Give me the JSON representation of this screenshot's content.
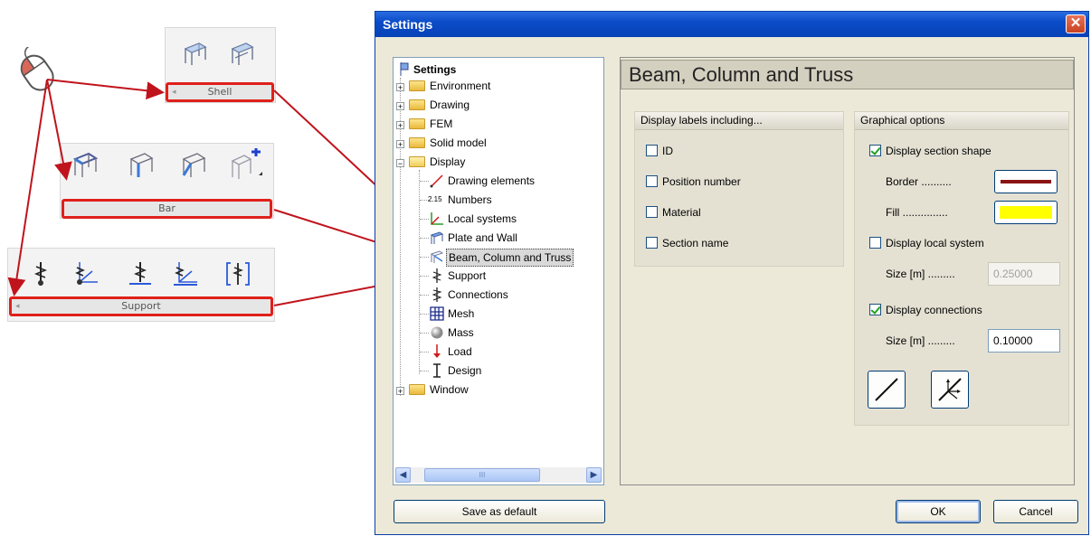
{
  "toolbars": {
    "shell": {
      "caption": "Shell"
    },
    "bar": {
      "caption": "Bar"
    },
    "support": {
      "caption": "Support"
    }
  },
  "dialog": {
    "title": "Settings",
    "close_glyph": "✕",
    "tree": {
      "root": "Settings",
      "items": [
        {
          "label": "Environment",
          "type": "folder"
        },
        {
          "label": "Drawing",
          "type": "folder"
        },
        {
          "label": "FEM",
          "type": "folder"
        },
        {
          "label": "Solid model",
          "type": "folder"
        },
        {
          "label": "Display",
          "type": "open-folder"
        },
        {
          "label": "Drawing elements",
          "icon": "drawing-elements-icon"
        },
        {
          "label": "Numbers",
          "icon": "numbers-icon",
          "icon_text": "2.15"
        },
        {
          "label": "Local systems",
          "icon": "local-systems-icon"
        },
        {
          "label": "Plate and Wall",
          "icon": "plate-wall-icon"
        },
        {
          "label": "Beam, Column and Truss",
          "icon": "beam-icon",
          "selected": true
        },
        {
          "label": "Support",
          "icon": "support-icon"
        },
        {
          "label": "Connections",
          "icon": "connections-icon"
        },
        {
          "label": "Mesh",
          "icon": "mesh-icon"
        },
        {
          "label": "Mass",
          "icon": "mass-icon"
        },
        {
          "label": "Load",
          "icon": "load-icon"
        },
        {
          "label": "Design",
          "icon": "design-icon"
        },
        {
          "label": "Window",
          "type": "folder"
        }
      ],
      "scroll_thumb": "III"
    },
    "panel": {
      "title": "Beam, Column and Truss",
      "labels_group": {
        "title": "Display labels including...",
        "options": [
          {
            "label": "ID",
            "checked": false
          },
          {
            "label": "Position number",
            "checked": false
          },
          {
            "label": "Material",
            "checked": false
          },
          {
            "label": "Section name",
            "checked": false
          }
        ]
      },
      "graphical_group": {
        "title": "Graphical options",
        "display_section_shape": {
          "label": "Display section shape",
          "checked": true
        },
        "border": {
          "label": "Border ..........",
          "color": "#8b1414"
        },
        "fill": {
          "label": "Fill ...............",
          "color": "#ffff00"
        },
        "display_local_system": {
          "label": "Display local system",
          "checked": false
        },
        "local_size": {
          "label": "Size [m] .........",
          "value": "0.25000"
        },
        "display_connections": {
          "label": "Display connections",
          "checked": true
        },
        "conn_size": {
          "label": "Size [m] .........",
          "value": "0.10000"
        }
      }
    },
    "buttons": {
      "save_default": "Save as default",
      "ok": "OK",
      "cancel": "Cancel"
    }
  },
  "colors": {
    "arrow": "#c0141c",
    "highlight": "#e0201a",
    "titlebar": "#0a4cc8"
  }
}
